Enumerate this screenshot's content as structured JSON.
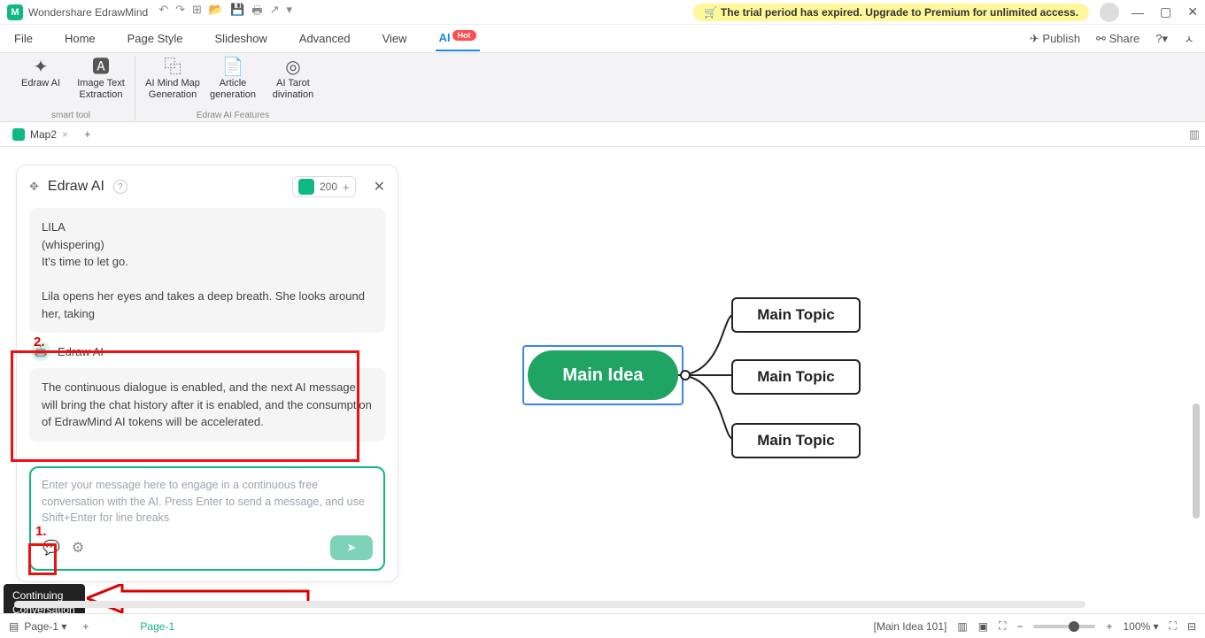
{
  "app": {
    "title": "Wondershare EdrawMind"
  },
  "titlebar": {
    "trial_banner": "The trial period has expired. Upgrade to Premium for unlimited access."
  },
  "menu": {
    "items": [
      "File",
      "Home",
      "Page Style",
      "Slideshow",
      "Advanced",
      "View",
      "AI"
    ],
    "active": "AI",
    "hot_badge": "Hot",
    "publish": "Publish",
    "share": "Share"
  },
  "ribbon": {
    "groups": [
      {
        "name": "smart tool",
        "buttons": [
          "Edraw AI",
          "Image Text Extraction"
        ]
      },
      {
        "name": "Edraw AI Features",
        "buttons": [
          "AI Mind Map Generation",
          "Article generation",
          "AI Tarot divination"
        ]
      }
    ]
  },
  "doctab": {
    "name": "Map2"
  },
  "ai_panel": {
    "title": "Edraw AI",
    "tokens": "200",
    "message1": "LILA\n(whispering)\nIt's time to let go.\n\nLila opens her eyes and takes a deep breath. She looks around her, taking",
    "bot_name": "Edraw AI",
    "message2": "The continuous dialogue is enabled, and the next AI message will bring the chat history after it is enabled, and the consumption of EdrawMind AI tokens will be accelerated.",
    "placeholder": "Enter your message here to engage in a continuous free conversation with the AI. Press Enter to send a message, and use Shift+Enter for line breaks"
  },
  "annotations": {
    "n1": "1.",
    "n2": "2.",
    "tooltip": "Continuing Conversation"
  },
  "mindmap": {
    "center": "Main Idea",
    "topics": [
      "Main Topic",
      "Main Topic",
      "Main Topic"
    ]
  },
  "status": {
    "page_label": "Page-1",
    "page_list": "Page-1",
    "selection": "[Main Idea 101]",
    "zoom": "100%"
  }
}
